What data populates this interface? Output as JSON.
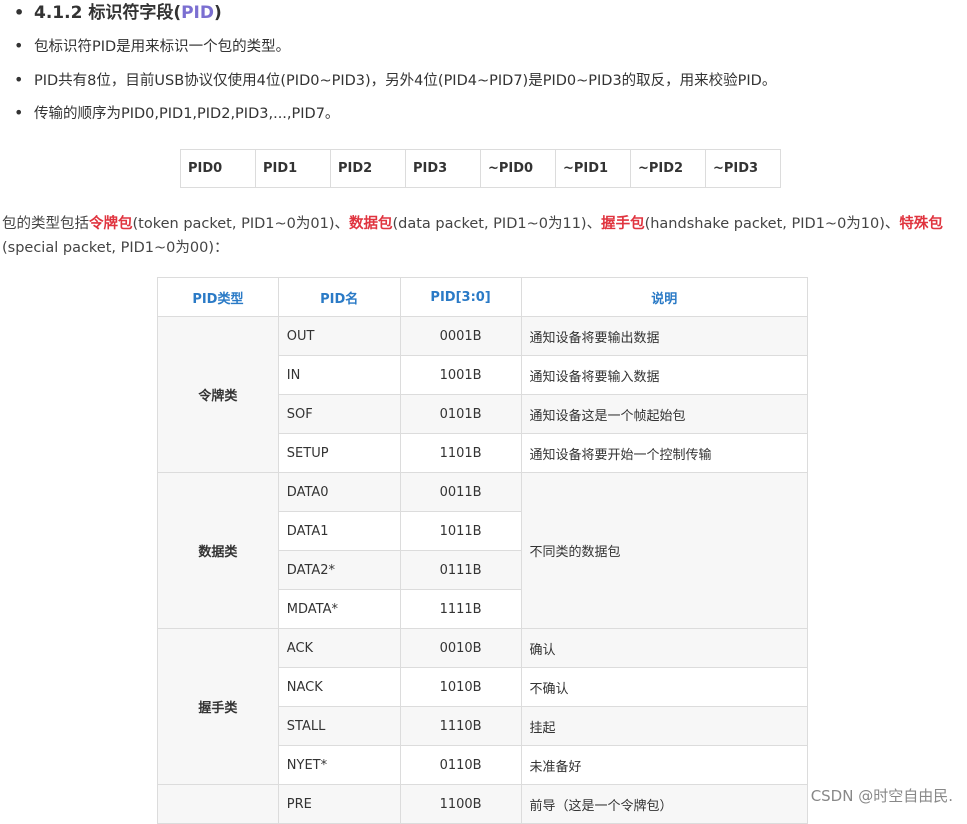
{
  "heading": {
    "prefix": "4.1.2 标识符字段(",
    "pid": "PID",
    "suffix": ")"
  },
  "bullets": [
    "包标识符PID是用来标识一个包的类型。",
    "PID共有8位，目前USB协议仅使用4位(PID0~PID3)，另外4位(PID4~PID7)是PID0~PID3的取反，用来校验PID。",
    "传输的顺序为PID0,PID1,PID2,PID3,...,PID7。"
  ],
  "bit_table": [
    "PID0",
    "PID1",
    "PID2",
    "PID3",
    "~PID0",
    "~PID1",
    "~PID2",
    "~PID3"
  ],
  "intro": {
    "p1": " 包的类型包括",
    "token": "令牌包",
    "p2": "(token packet, PID1~0为01)、",
    "data": "数据包",
    "p3": "(data packet, PID1~0为11)、",
    "handshake": "握手包",
    "p4": "(handshake packet, PID1~0为10)、",
    "special": "特殊包",
    "p5": "(special packet, PID1~0为00)："
  },
  "table": {
    "headers": [
      "PID类型",
      "PID名",
      "PID[3:0]",
      "说明"
    ],
    "groups": {
      "token": "令牌类",
      "data": "数据类",
      "handshake": "握手类"
    },
    "rows": [
      {
        "name": "OUT",
        "code": "0001B",
        "desc": "通知设备将要输出数据"
      },
      {
        "name": "IN",
        "code": "1001B",
        "desc": "通知设备将要输入数据"
      },
      {
        "name": "SOF",
        "code": "0101B",
        "desc": "通知设备这是一个帧起始包"
      },
      {
        "name": "SETUP",
        "code": "1101B",
        "desc": "通知设备将要开始一个控制传输"
      },
      {
        "name": "DATA0",
        "code": "0011B"
      },
      {
        "name": "DATA1",
        "code": "1011B"
      },
      {
        "name": "DATA2*",
        "code": "0111B"
      },
      {
        "name": "MDATA*",
        "code": "1111B"
      },
      {
        "name": "ACK",
        "code": "0010B",
        "desc": "确认"
      },
      {
        "name": "NACK",
        "code": "1010B",
        "desc": "不确认"
      },
      {
        "name": "STALL",
        "code": "1110B",
        "desc": "挂起"
      },
      {
        "name": "NYET*",
        "code": "0110B",
        "desc": "未准备好"
      },
      {
        "name": "PRE",
        "code": "1100B",
        "desc": "前导（这是一个令牌包）"
      }
    ],
    "data_desc": "不同类的数据包"
  },
  "watermark": "CSDN @时空自由民."
}
